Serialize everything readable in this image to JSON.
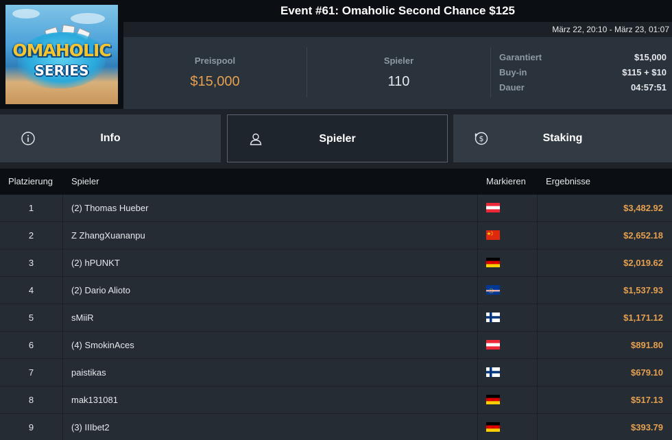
{
  "event": {
    "title": "Event #61: Omaholic Second Chance $125",
    "dates": "März 22, 20:10 - März 23, 01:07",
    "logo": {
      "line1": "OMAHOLIC",
      "line2": "SERIES"
    }
  },
  "stats": {
    "prizepool_label": "Preispool",
    "prizepool_value": "$15,000",
    "players_label": "Spieler",
    "players_value": "110",
    "guaranteed_label": "Garantiert",
    "guaranteed_value": "$15,000",
    "buyin_label": "Buy-in",
    "buyin_value": "$115 + $10",
    "duration_label": "Dauer",
    "duration_value": "04:57:51"
  },
  "tabs": [
    {
      "label": "Info",
      "icon": "info-icon"
    },
    {
      "label": "Spieler",
      "icon": "user-icon"
    },
    {
      "label": "Staking",
      "icon": "dollar-coin-icon"
    }
  ],
  "table": {
    "columns": [
      "Platzierung",
      "Spieler",
      "Markieren",
      "Ergebnisse"
    ],
    "rows": [
      {
        "rank": "1",
        "player": "(2) Thomas Hueber",
        "flag": "austria",
        "result": "$3,482.92"
      },
      {
        "rank": "2",
        "player": "Z ZhangXuananpu",
        "flag": "china",
        "result": "$2,652.18"
      },
      {
        "rank": "3",
        "player": "(2) hPUNKT",
        "flag": "germany",
        "result": "$2,019.62"
      },
      {
        "rank": "4",
        "player": "(2) Dario Alioto",
        "flag": "cape-verde",
        "result": "$1,537.93"
      },
      {
        "rank": "5",
        "player": "sMiiR",
        "flag": "finland",
        "result": "$1,171.12"
      },
      {
        "rank": "6",
        "player": "(4) SmokinAces",
        "flag": "austria",
        "result": "$891.80"
      },
      {
        "rank": "7",
        "player": "paistikas",
        "flag": "finland",
        "result": "$679.10"
      },
      {
        "rank": "8",
        "player": "mak131081",
        "flag": "germany",
        "result": "$517.13"
      },
      {
        "rank": "9",
        "player": "(3) IIIbet2",
        "flag": "germany",
        "result": "$393.79"
      }
    ]
  },
  "colors": {
    "accent": "#e6a050",
    "background": "#1e2329",
    "panel": "#2a323b",
    "header": "#0b0e12"
  }
}
